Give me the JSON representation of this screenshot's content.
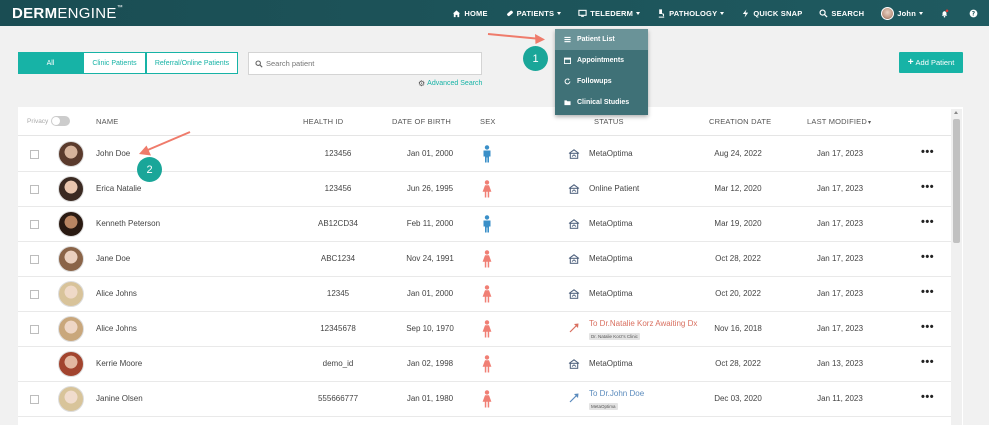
{
  "brand": {
    "logo_bold": "DERM",
    "logo_light": "ENGINE",
    "logo_tm": "™"
  },
  "nav": {
    "home": "HOME",
    "patients": "PATIENTS",
    "teleDerm": "TELEDERM",
    "pathology": "PATHOLOGY",
    "quickSnap": "QUICK SNAP",
    "search": "SEARCH",
    "user": "John"
  },
  "dropdown": {
    "items": [
      "Patient List",
      "Appointments",
      "Followups",
      "Clinical Studies"
    ]
  },
  "annotations": {
    "step1": "1",
    "step2": "2"
  },
  "filters": {
    "all": "All",
    "clinic": "Clinic Patients",
    "referral": "Referral/Online Patients"
  },
  "search": {
    "placeholder": "Search patient",
    "advanced": "Advanced Search"
  },
  "actions": {
    "add_patient": "Add Patient"
  },
  "table": {
    "privacy_label": "Privacy",
    "headers": {
      "name": "NAME",
      "health_id": "HEALTH ID",
      "dob": "DATE OF BIRTH",
      "sex": "SEX",
      "status": "STATUS",
      "creation_date": "CREATION DATE",
      "last_modified": "LAST MODIFIED"
    },
    "rows": [
      {
        "name": "John Doe",
        "health_id": "123456",
        "dob": "Jan 01, 2000",
        "sex": "male",
        "status": "MetaOptima",
        "status_kind": "clinic",
        "tag": "",
        "created": "Aug 24, 2022",
        "modified": "Jan 17, 2023",
        "more": "•••"
      },
      {
        "name": "Erica Natalie",
        "health_id": "123456",
        "dob": "Jun 26, 1995",
        "sex": "female",
        "status": "Online Patient",
        "status_kind": "clinic",
        "tag": "",
        "created": "Mar 12, 2020",
        "modified": "Jan 17, 2023",
        "more": "•••"
      },
      {
        "name": "Kenneth Peterson",
        "health_id": "AB12CD34",
        "dob": "Feb 11, 2000",
        "sex": "male",
        "status": "MetaOptima",
        "status_kind": "clinic",
        "tag": "",
        "created": "Mar 19, 2020",
        "modified": "Jan 17, 2023",
        "more": "•••"
      },
      {
        "name": "Jane Doe",
        "health_id": "ABC1234",
        "dob": "Nov 24, 1991",
        "sex": "female",
        "status": "MetaOptima",
        "status_kind": "clinic",
        "tag": "",
        "created": "Oct 28, 2022",
        "modified": "Jan 17, 2023",
        "more": "•••"
      },
      {
        "name": "Alice Johns",
        "health_id": "12345",
        "dob": "Jan 01, 2000",
        "sex": "female",
        "status": "MetaOptima",
        "status_kind": "clinic",
        "tag": "",
        "created": "Oct 20, 2022",
        "modified": "Jan 17, 2023",
        "more": "•••"
      },
      {
        "name": "Alice Johns",
        "health_id": "12345678",
        "dob": "Sep 10, 1970",
        "sex": "female",
        "status": "To Dr.Natalie Korz Awaiting Dx",
        "status_kind": "referral-red",
        "tag": "Dr. Natalie Korz's Clinic",
        "created": "Nov 16, 2018",
        "modified": "Jan 17, 2023",
        "more": "•••"
      },
      {
        "name": "Kerrie Moore",
        "health_id": "demo_id",
        "dob": "Jan 02, 1998",
        "sex": "female",
        "status": "MetaOptima",
        "status_kind": "clinic",
        "tag": "",
        "created": "Oct 28, 2022",
        "modified": "Jan 13, 2023",
        "more": "•••"
      },
      {
        "name": "Janine Olsen",
        "health_id": "555666777",
        "dob": "Jan 01, 1980",
        "sex": "female",
        "status": "To Dr.John Doe",
        "status_kind": "referral-blue",
        "tag": "MetaOptima",
        "created": "Dec 03, 2020",
        "modified": "Jan 11, 2023",
        "more": "•••"
      }
    ]
  },
  "colors": {
    "accent": "#17b3a6",
    "topbar": "#1c5358",
    "male": "#3a8fc8",
    "female": "#f07f74",
    "referral_red": "#d97060",
    "referral_blue": "#5b8bbd"
  }
}
